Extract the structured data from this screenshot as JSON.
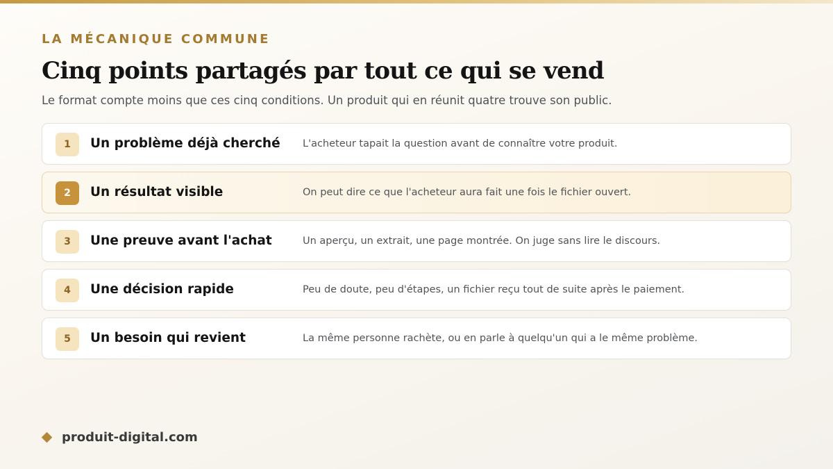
{
  "header": {
    "eyebrow": "LA MÉCANIQUE COMMUNE",
    "title": "Cinq points partagés par tout ce qui se vend",
    "subtitle": "Le format compte moins que ces cinq conditions. Un produit qui en réunit quatre trouve son public."
  },
  "items": [
    {
      "num": "1",
      "label": "Un problème déjà cherché",
      "desc": "L'acheteur tapait la question avant de connaître votre produit."
    },
    {
      "num": "2",
      "label": "Un résultat visible",
      "desc": "On peut dire ce que l'acheteur aura fait une fois le fichier ouvert."
    },
    {
      "num": "3",
      "label": "Une preuve avant l'achat",
      "desc": "Un aperçu, un extrait, une page montrée. On juge sans lire le discours."
    },
    {
      "num": "4",
      "label": "Une décision rapide",
      "desc": "Peu de doute, peu d'étapes, un fichier reçu tout de suite après le paiement."
    },
    {
      "num": "5",
      "label": "Un besoin qui revient",
      "desc": "La même personne rachète, ou en parle à quelqu'un qui a le même problème."
    }
  ],
  "footer": {
    "icon": "diamond-icon",
    "site": "produit-digital.com"
  },
  "colors": {
    "accent": "#c49a43",
    "highlight_bg": "#fbf0d9",
    "badge_bg": "#f5e4be"
  }
}
